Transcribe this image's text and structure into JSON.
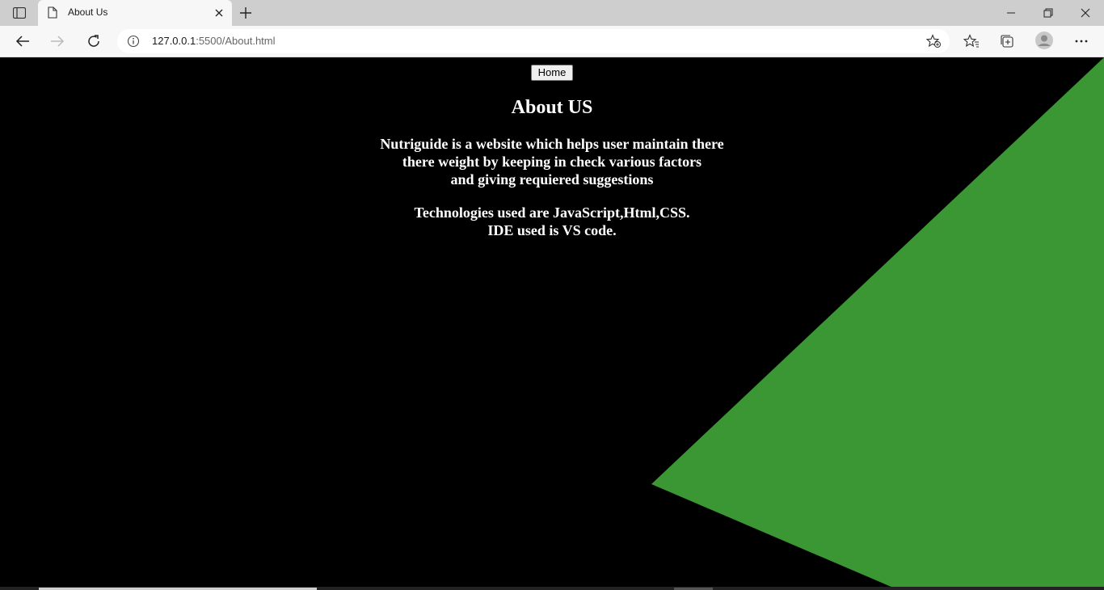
{
  "browser": {
    "tab": {
      "title": "About Us"
    },
    "address": {
      "host": "127.0.0.1",
      "path": ":5500/About.html"
    },
    "icons": {
      "tab_actions": "tab-actions-icon",
      "page": "page-icon",
      "close": "close-icon",
      "new_tab": "plus-icon",
      "back": "arrow-left-icon",
      "forward": "arrow-right-icon",
      "reload": "reload-icon",
      "info": "info-icon",
      "add_favorite": "star-plus-icon",
      "favorites": "favorites-icon",
      "collections": "collections-icon",
      "profile": "avatar-icon",
      "more": "more-icon"
    }
  },
  "page": {
    "home_button": "Home",
    "title": "About US",
    "description_lines": [
      "Nutriguide is a website which helps user maintain there",
      "there weight by keeping in check various factors",
      "and giving requiered suggestions"
    ],
    "tech_lines": [
      "Technologies used are JavaScript,Html,CSS.",
      "IDE used is VS code."
    ],
    "colors": {
      "background": "#000000",
      "accent_shape": "#3a9733",
      "text": "#ffffff"
    }
  }
}
